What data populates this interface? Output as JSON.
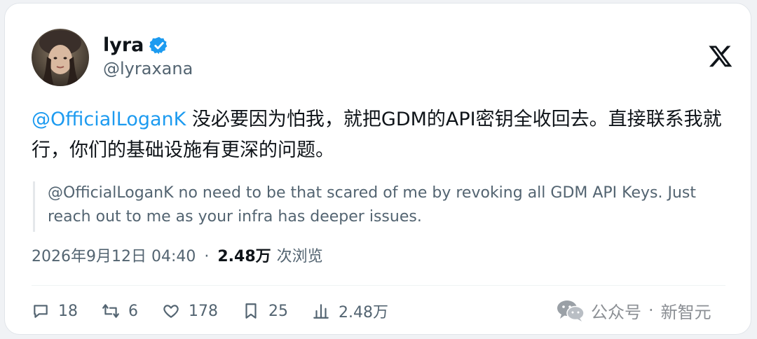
{
  "author": {
    "name": "lyra",
    "handle": "@lyraxana",
    "verified_icon": "verified-badge-icon"
  },
  "platform_logo": "x-logo",
  "tweet": {
    "mention": "@OfficialLoganK",
    "text": " 没必要因为怕我，就把GDM的API密钥全收回去。直接联系我就行，你们的基础设施有更深的问题。"
  },
  "quote": {
    "text": "@OfficialLoganK no need to be that scared of me by revoking all GDM API Keys. Just reach out to me as your infra has deeper issues."
  },
  "meta": {
    "timestamp": "2026年9月12日 04:40",
    "separator": "·",
    "views": "2.48万",
    "views_label": "次浏览"
  },
  "actions": [
    {
      "icon": "reply-icon",
      "count": "18"
    },
    {
      "icon": "retweet-icon",
      "count": "6"
    },
    {
      "icon": "like-icon",
      "count": "178"
    },
    {
      "icon": "bookmark-icon",
      "count": "25"
    },
    {
      "icon": "views-chart-icon",
      "count": "2.48万"
    }
  ],
  "watermark": {
    "icon": "wechat-icon",
    "source": "公众号",
    "separator": "·",
    "account": "新智元"
  },
  "colors": {
    "accent": "#1d9bf0",
    "text": "#0f1419",
    "muted": "#536471"
  }
}
